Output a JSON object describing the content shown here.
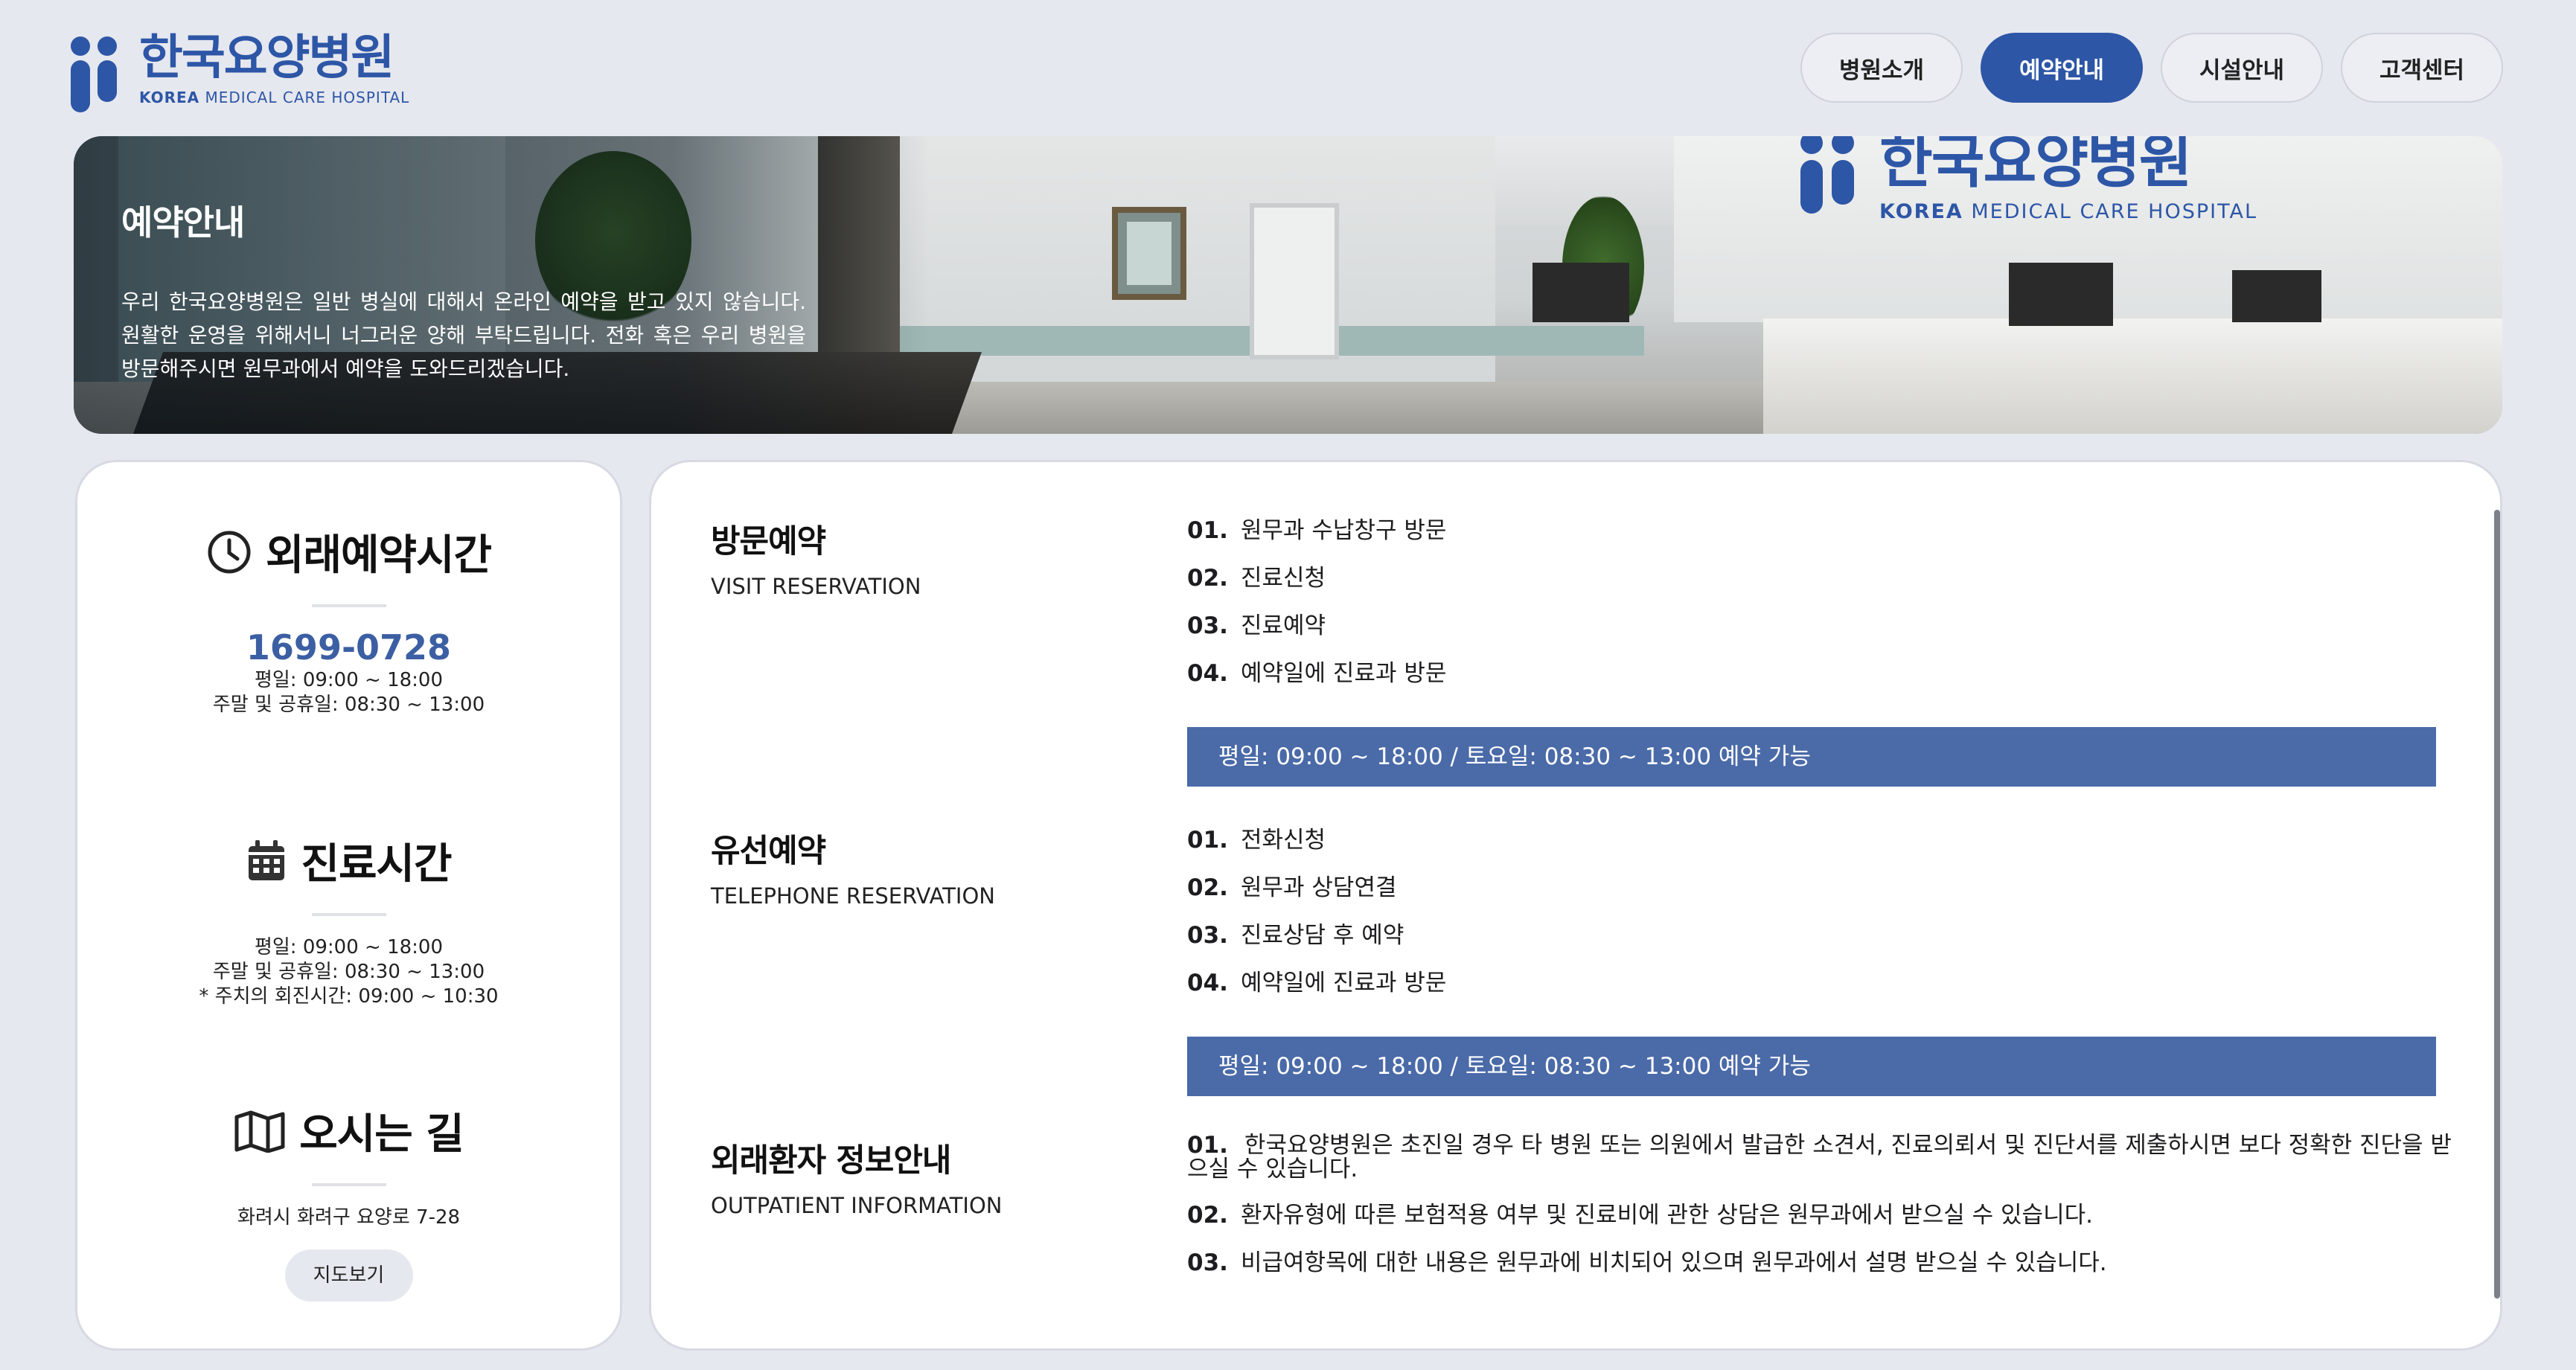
{
  "brand": {
    "name_ko": "한국요양병원",
    "name_en_bold": "KOREA",
    "name_en_rest": "MEDICAL CARE HOSPITAL",
    "color": "#2d56a6"
  },
  "nav": {
    "items": [
      {
        "label": "병원소개",
        "active": false
      },
      {
        "label": "예약안내",
        "active": true
      },
      {
        "label": "시설안내",
        "active": false
      },
      {
        "label": "고객센터",
        "active": false
      }
    ]
  },
  "banner": {
    "title": "예약안내",
    "description": "우리 한국요양병원은 일반 병실에 대해서 온라인 예약을 받고 있지 않습니다. 원활한 운영을 위해서니 너그러운 양해 부탁드립니다. 전화 혹은 우리 병원을 방문해주시면 원무과에서 예약을 도와드리겠습니다."
  },
  "sidebar": {
    "outpatient_hours": {
      "icon": "clock-icon",
      "title": "외래예약시간",
      "phone": "1699-0728",
      "lines": [
        "평일: 09:00 ~ 18:00",
        "주말 및 공휴일: 08:30 ~ 13:00"
      ]
    },
    "clinic_hours": {
      "icon": "calendar-icon",
      "title": "진료시간",
      "lines": [
        "평일: 09:00 ~ 18:00",
        "주말 및 공휴일: 08:30 ~ 13:00",
        "* 주치의 회진시간: 09:00 ~ 10:30"
      ]
    },
    "directions": {
      "icon": "map-icon",
      "title": "오시는 길",
      "address": "화려시 화려구 요양로 7-28",
      "button": "지도보기"
    }
  },
  "sections": [
    {
      "title": "방문예약",
      "subtitle": "VISIT RESERVATION",
      "items": [
        {
          "num": "01.",
          "text": "원무과 수납창구 방문"
        },
        {
          "num": "02.",
          "text": "진료신청"
        },
        {
          "num": "03.",
          "text": "진료예약"
        },
        {
          "num": "04.",
          "text": "예약일에 진료과 방문"
        }
      ],
      "note": "평일: 09:00 ~ 18:00 / 토요일: 08:30 ~ 13:00 예약 가능"
    },
    {
      "title": "유선예약",
      "subtitle": "TELEPHONE RESERVATION",
      "items": [
        {
          "num": "01.",
          "text": "전화신청"
        },
        {
          "num": "02.",
          "text": "원무과 상담연결"
        },
        {
          "num": "03.",
          "text": "진료상담 후 예약"
        },
        {
          "num": "04.",
          "text": "예약일에 진료과 방문"
        }
      ],
      "note": "평일: 09:00 ~ 18:00 / 토요일: 08:30 ~ 13:00 예약 가능"
    },
    {
      "title": "외래환자 정보안내",
      "subtitle": "OUTPATIENT INFORMATION",
      "items": [
        {
          "num": "01.",
          "text": "한국요양병원은 초진일 경우 타 병원 또는 의원에서 발급한 소견서, 진료의뢰서 및 진단서를 제출하시면 보다 정확한 진단을 받으실 수 있습니다."
        },
        {
          "num": "02.",
          "text": "환자유형에 따른 보험적용 여부 및 진료비에 관한 상담은 원무과에서 받으실 수 있습니다."
        },
        {
          "num": "03.",
          "text": "비급여항목에 대한 내용은 원무과에 비치되어 있으며 원무과에서 설명 받으실 수 있습니다."
        }
      ]
    }
  ]
}
